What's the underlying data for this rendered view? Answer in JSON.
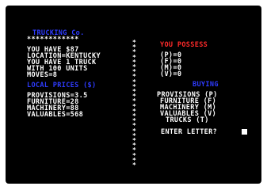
{
  "title": "TRUCKING Co.",
  "title_underline": "************",
  "status": [
    "YOU HAVE $87",
    "LOCATION=KENTUCKY",
    "YOU HAVE 1 TRUCK",
    "WITH 100 UNITS",
    "MOVES=8"
  ],
  "local_prices_header": "LOCAL PRICES ($)",
  "local_prices": [
    "PROVISIONS=3.5",
    "FURNITURE=28",
    "MACHINERY=88",
    "VALUABLES=568"
  ],
  "divider_char": "*",
  "divider_count": 26,
  "you_possess_header": "YOU POSSESS",
  "possessions": [
    "(P)=0",
    "(F)=0",
    "(M)=0",
    "(V)=0"
  ],
  "buying_header": "BUYING",
  "buying_options": [
    "PROVISIONS (P)",
    "FURNITURE (F)",
    "MACHINERY (M)",
    "VALUABLES (V)",
    "TRUCKS (T)"
  ],
  "prompt": "ENTER LETTER?",
  "colors": {
    "background": "#000000",
    "text": "#ffffff",
    "heading_blue": "#2e3bff",
    "heading_red": "#ff2a2a"
  }
}
